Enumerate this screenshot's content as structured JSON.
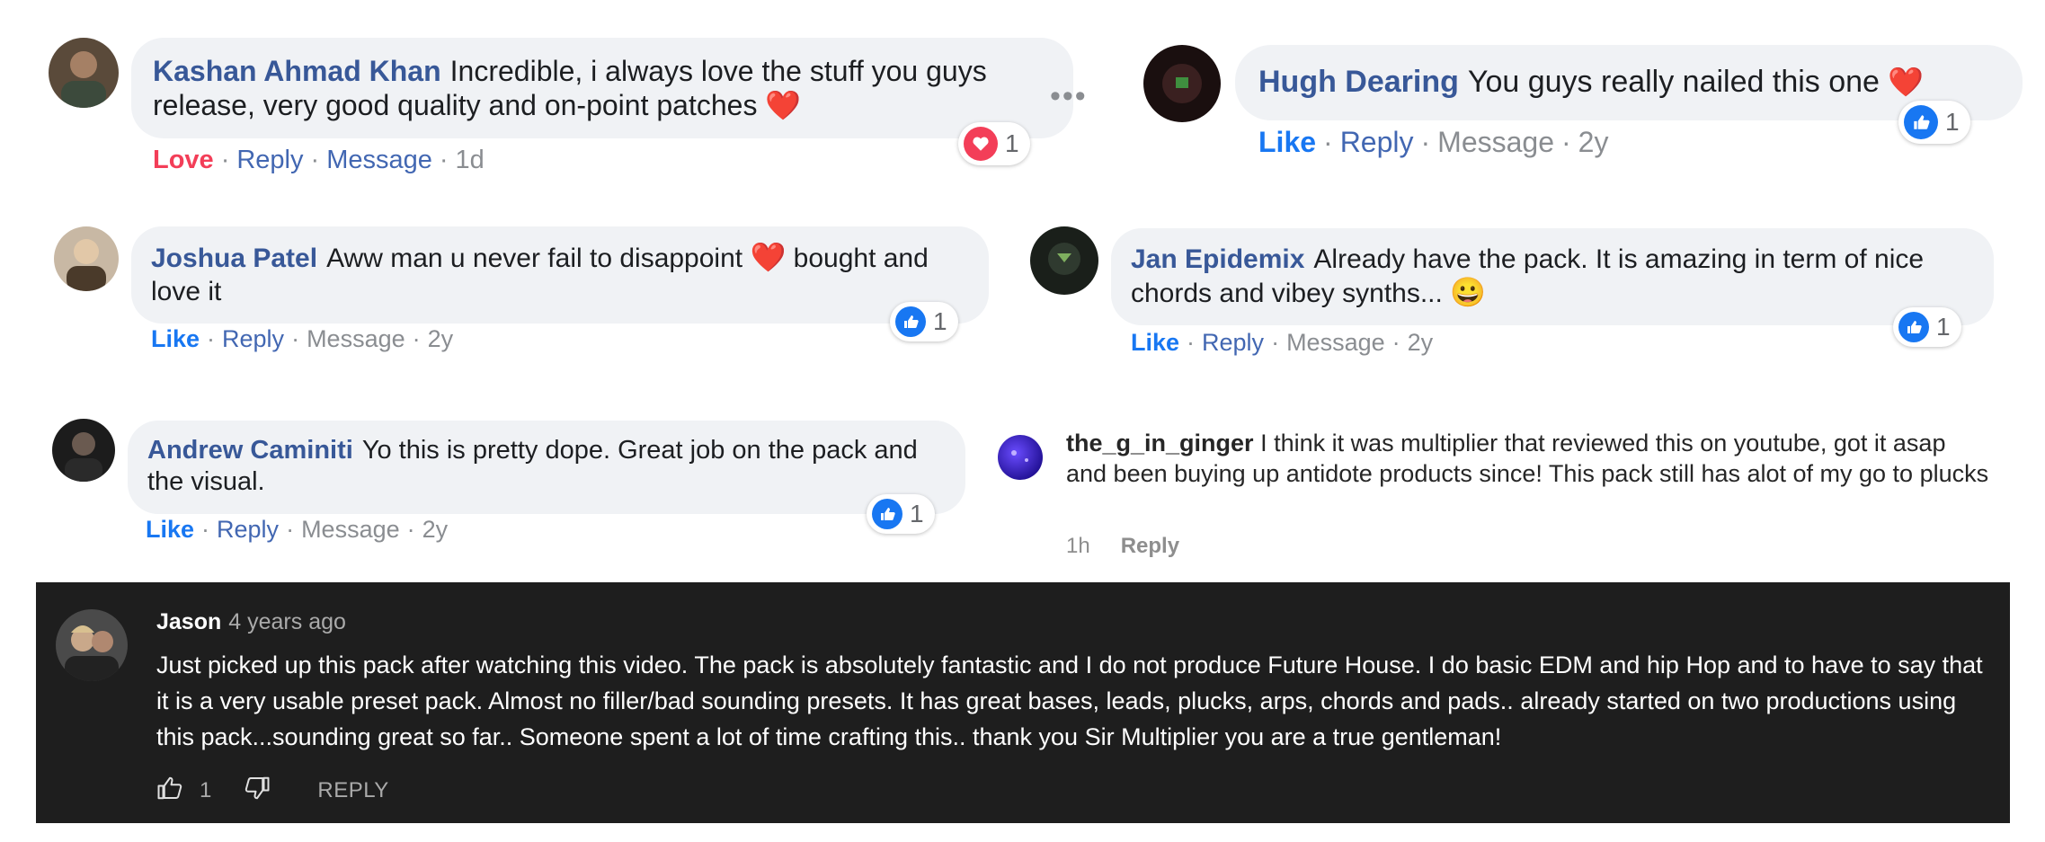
{
  "comments": [
    {
      "author": "Kashan Ahmad Khan",
      "text": "Incredible, i always love the stuff you guys release, very good quality and on-point patches",
      "emoji": "❤️",
      "reaction_label": "Love",
      "reply": "Reply",
      "message": "Message",
      "time": "1d",
      "reaction_count": "1"
    },
    {
      "author": "Hugh Dearing",
      "text": "You guys really nailed this one",
      "emoji": "❤️",
      "reaction_label": "Like",
      "reply": "Reply",
      "message": "Message",
      "time": "2y",
      "reaction_count": "1"
    },
    {
      "author": "Joshua Patel",
      "text_a": "Aww man u never fail to disappoint",
      "emoji": "❤️",
      "text_b": "bought and love it",
      "reaction_label": "Like",
      "reply": "Reply",
      "message": "Message",
      "time": "2y",
      "reaction_count": "1"
    },
    {
      "author": "Jan Epidemix",
      "text": "Already have the pack. It is amazing in term of nice chords and vibey synths...",
      "emoji": "😀",
      "reaction_label": "Like",
      "reply": "Reply",
      "message": "Message",
      "time": "2y",
      "reaction_count": "1"
    },
    {
      "author": "Andrew Caminiti",
      "text": "Yo this is pretty dope. Great job on the pack and the visual.",
      "reaction_label": "Like",
      "reply": "Reply",
      "message": "Message",
      "time": "2y",
      "reaction_count": "1"
    }
  ],
  "instagram": {
    "username": "the_g_in_ginger",
    "text": "I think it was multiplier that reviewed this on youtube, got it asap and been buying up antidote products since! This pack still has alot of my go to plucks",
    "time": "1h",
    "reply": "Reply"
  },
  "youtube": {
    "author": "Jason",
    "time": "4 years ago",
    "text": "Just picked up this pack after watching this video. The pack is absolutely fantastic and I do not produce Future House. I do basic EDM and hip Hop and to have to say that it is a very usable preset pack. Almost no filler/bad sounding presets. It has great bases, leads, plucks, arps, chords and pads.. already started on two productions using this pack...sounding great so far.. Someone spent a lot of time crafting this.. thank you Sir Multiplier you are a true gentleman!",
    "like_count": "1",
    "reply": "REPLY",
    "background": "#1e1e1e"
  },
  "colors": {
    "author": "#385898",
    "bubble": "#f0f2f5",
    "like_blue": "#1877f2",
    "love_red": "#f33e58"
  }
}
